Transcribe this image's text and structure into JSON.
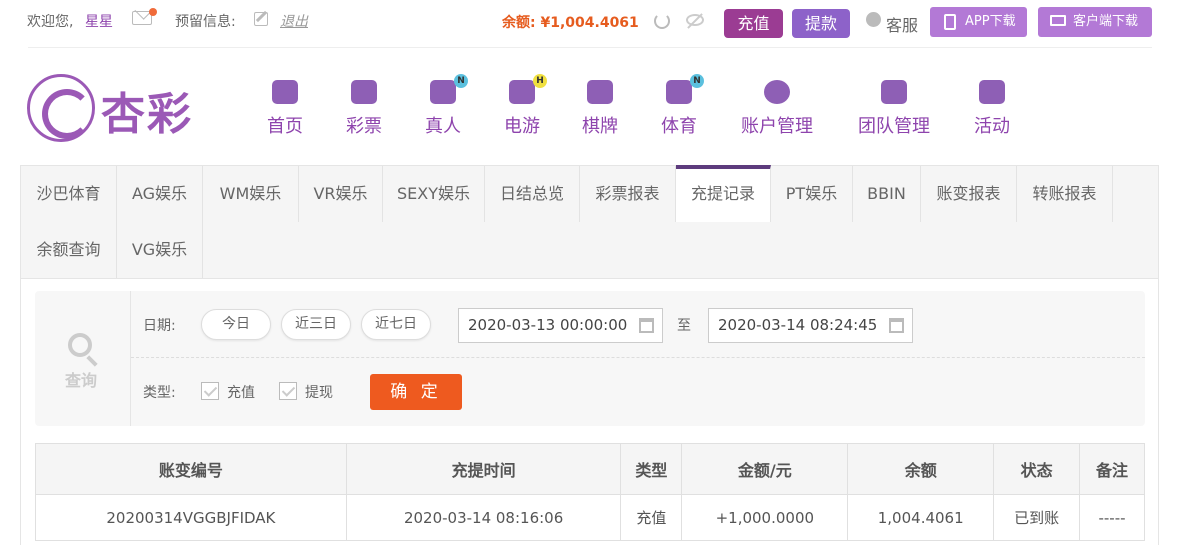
{
  "topbar": {
    "welcome": "欢迎您,",
    "username": "星星",
    "reserved_label": "预留信息:",
    "logout": "退出",
    "balance_label": "余额: ",
    "balance_value": "¥1,004.4061",
    "recharge": "充值",
    "withdraw": "提款",
    "customer_service": "客服",
    "app_download": "APP下载",
    "client_download": "客户端下载"
  },
  "logo": {
    "text": "杏彩"
  },
  "nav": [
    {
      "label": "首页",
      "icon": "home-icon"
    },
    {
      "label": "彩票",
      "icon": "ticket-icon"
    },
    {
      "label": "真人",
      "icon": "dealer-icon",
      "badge": "N"
    },
    {
      "label": "电游",
      "icon": "gamepad-icon",
      "badge": "H"
    },
    {
      "label": "棋牌",
      "icon": "cards-icon"
    },
    {
      "label": "体育",
      "icon": "trophy-icon",
      "badge": "N"
    },
    {
      "label": "账户管理",
      "icon": "yen-coin-icon"
    },
    {
      "label": "团队管理",
      "icon": "team-icon"
    },
    {
      "label": "活动",
      "icon": "gift-icon"
    }
  ],
  "tabs": [
    "沙巴体育",
    "AG娱乐",
    "WM娱乐",
    "VR娱乐",
    "SEXY娱乐",
    "日结总览",
    "彩票报表",
    "充提记录",
    "PT娱乐",
    "BBIN",
    "账变报表",
    "转账报表",
    "余额查询",
    "VG娱乐"
  ],
  "active_tab": "充提记录",
  "filter": {
    "query_label": "查询",
    "date_label": "日期:",
    "today": "今日",
    "three_days": "近三日",
    "seven_days": "近七日",
    "start_date": "2020-03-13 00:00:00",
    "to": "至",
    "end_date": "2020-03-14 08:24:45",
    "type_label": "类型:",
    "type_recharge": "充值",
    "type_withdraw": "提现",
    "confirm": "确 定"
  },
  "table": {
    "headers": [
      "账变编号",
      "充提时间",
      "类型",
      "金额/元",
      "余额",
      "状态",
      "备注"
    ],
    "rows": [
      [
        "20200314VGGBJFIDAK",
        "2020-03-14 08:16:06",
        "充值",
        "+1,000.0000",
        "1,004.4061",
        "已到账",
        "-----"
      ]
    ]
  },
  "colors": {
    "accent": "#8e44ad",
    "orange": "#ee5a1f"
  }
}
